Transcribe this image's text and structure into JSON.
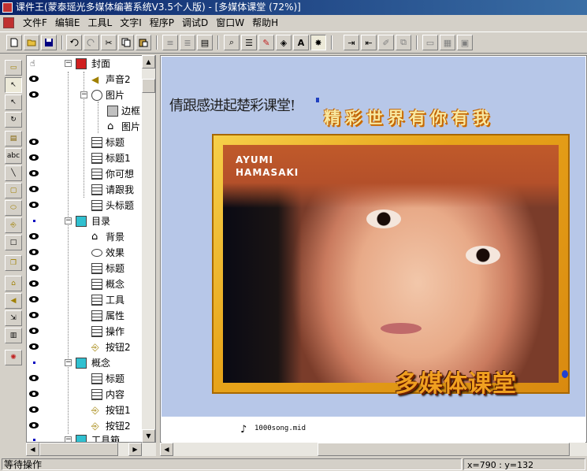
{
  "window": {
    "title": "课件王(蒙泰瑶光多媒体编著系统V3.5个人版) - [多媒体课堂 (72%)]"
  },
  "menu": [
    "文件F",
    "编辑E",
    "工具L",
    "文字I",
    "程序P",
    "调试D",
    "窗口W",
    "帮助H"
  ],
  "tree": {
    "items": [
      {
        "label": "封面",
        "icon": "page-red-icon"
      },
      {
        "label": "声音2",
        "icon": "speaker-icon"
      },
      {
        "label": "图片",
        "icon": "picture-icon"
      },
      {
        "label": "边框",
        "icon": "frame-icon"
      },
      {
        "label": "图片",
        "icon": "house-icon"
      },
      {
        "label": "标题",
        "icon": "text-icon"
      },
      {
        "label": "标题1",
        "icon": "text-icon"
      },
      {
        "label": "你可想",
        "icon": "text-icon"
      },
      {
        "label": "请跟我",
        "icon": "text-icon"
      },
      {
        "label": "头标题",
        "icon": "text-icon"
      },
      {
        "label": "目录",
        "icon": "page-cyan-icon"
      },
      {
        "label": "背景",
        "icon": "house-icon"
      },
      {
        "label": "效果",
        "icon": "ellipse-icon"
      },
      {
        "label": "标题",
        "icon": "text-icon"
      },
      {
        "label": "概念",
        "icon": "text-icon"
      },
      {
        "label": "工具",
        "icon": "text-icon"
      },
      {
        "label": "属性",
        "icon": "text-icon"
      },
      {
        "label": "操作",
        "icon": "text-icon"
      },
      {
        "label": "按钮2",
        "icon": "button-icon"
      },
      {
        "label": "概念",
        "icon": "page-cyan-icon"
      },
      {
        "label": "标题",
        "icon": "text-icon"
      },
      {
        "label": "内容",
        "icon": "text-icon"
      },
      {
        "label": "按钮1",
        "icon": "button-icon"
      },
      {
        "label": "按钮2",
        "icon": "button-icon"
      },
      {
        "label": "工具箱",
        "icon": "page-cyan-icon"
      }
    ]
  },
  "canvas": {
    "overlap_text": "倩跟感进起楚彩课堂!",
    "banner_text": "精彩世界有你有我",
    "photo_caption_1": "AYUMI",
    "photo_caption_2": "HAMASAKI",
    "bottom_title": "多媒体课堂",
    "media_file": "1000song.mid"
  },
  "status": {
    "left": "等待操作",
    "coords": "x=790 : y=132"
  }
}
